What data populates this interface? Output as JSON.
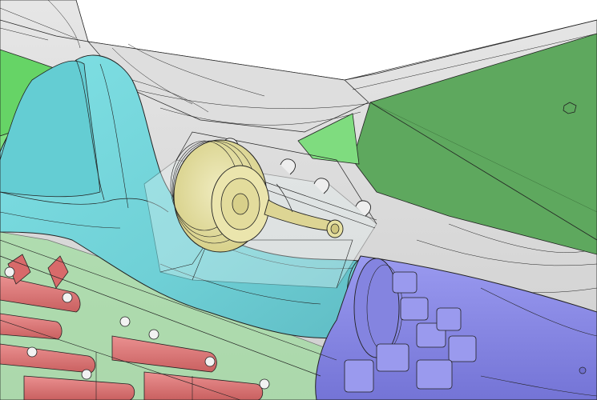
{
  "viewport": {
    "background": "#ffffff",
    "parts": [
      {
        "id": "airframe-skin",
        "color": "#d9d9d9",
        "opacity": "translucent"
      },
      {
        "id": "wing-panel",
        "color": "#5ea85e",
        "opacity": "opaque"
      },
      {
        "id": "left-green-structure",
        "color": "#66d466",
        "opacity": "translucent"
      },
      {
        "id": "intake-duct",
        "color": "#70d4d9",
        "opacity": "translucent"
      },
      {
        "id": "reservoir-drum",
        "color": "#e6e0a0",
        "opacity": "translucent"
      },
      {
        "id": "engine-casing",
        "color": "#8c8ce6",
        "opacity": "opaque"
      },
      {
        "id": "fuel-cylinders",
        "color": "#e07a7a",
        "opacity": "opaque"
      }
    ],
    "edge_color": "#222222"
  }
}
